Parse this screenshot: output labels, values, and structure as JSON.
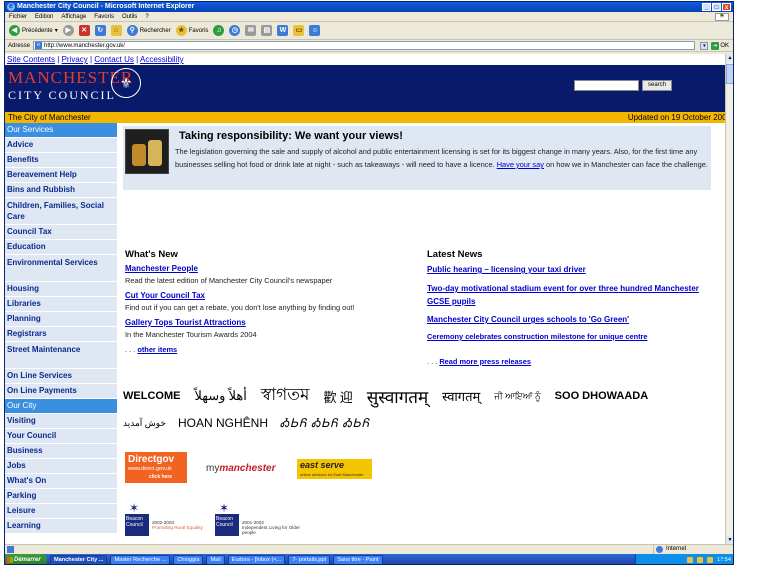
{
  "window": {
    "title": "Manchester City Council - Microsoft Internet Explorer",
    "controls": [
      "_",
      "□",
      "x"
    ]
  },
  "menu": [
    "Fichier",
    "Edition",
    "Affichage",
    "Favoris",
    "Outils",
    "?"
  ],
  "toolbar": {
    "back_label": "Précédente",
    "search_label": "Rechercher",
    "favorites_label": "Favoris"
  },
  "address": {
    "label": "Adresse",
    "url": "http://www.manchester.gov.uk/",
    "go_label": "OK"
  },
  "site": {
    "top_links": [
      "Site Contents",
      "Privacy",
      "Contact Us",
      "Accessibility"
    ],
    "logo_title": "MANCHESTER",
    "logo_subtitle": "CITY COUNCIL",
    "search_button": "search",
    "search_value": "",
    "strip_left": "The City of Manchester",
    "strip_right": "Updated on 19 October 2004"
  },
  "sidebar": [
    {
      "label": "Our Services",
      "head": true
    },
    {
      "label": "Advice"
    },
    {
      "label": "Benefits"
    },
    {
      "label": "Bereavement Help"
    },
    {
      "label": "Bins and Rubbish"
    },
    {
      "label": "Children, Families, Social Care",
      "tall": true
    },
    {
      "label": "Council Tax"
    },
    {
      "label": "Education"
    },
    {
      "label": "Environmental Services",
      "tall": true
    },
    {
      "label": "Housing"
    },
    {
      "label": "Libraries"
    },
    {
      "label": "Planning"
    },
    {
      "label": "Registrars"
    },
    {
      "label": "Street Maintenance",
      "tall": true
    },
    {
      "label": "On Line Services"
    },
    {
      "label": "On Line Payments"
    },
    {
      "label": "Our City",
      "head": true
    },
    {
      "label": "Visiting"
    },
    {
      "label": "Your Council"
    },
    {
      "label": "Business"
    },
    {
      "label": "Jobs"
    },
    {
      "label": "What's On"
    },
    {
      "label": "Parking"
    },
    {
      "label": "Leisure"
    },
    {
      "label": "Learning"
    }
  ],
  "feature": {
    "title": "Taking responsibility: We want your views!",
    "body": "The legislation governing the sale and supply of alcohol and public entertainment licensing is set for its biggest change in many years. Also, for the first time any businesses selling hot food or drink late at night - such as takeaways - will need to have a licence.",
    "link": "Have your say",
    "tail": " on how we in Manchester can face the challenge."
  },
  "whats_new": {
    "title": "What's New",
    "items": [
      {
        "link": "Manchester People",
        "desc": "Read the latest edition of Manchester City Council's newspaper"
      },
      {
        "link": "Cut Your Council Tax",
        "desc": "Find out if you can get a rebate, you don't lose anything by finding out!"
      },
      {
        "link": "Gallery Tops Tourist Attractions",
        "desc": "In the Manchester Tourism Awards 2004"
      }
    ],
    "more_prefix": ". . . ",
    "more_link": "other items"
  },
  "latest_news": {
    "title": "Latest News",
    "items": [
      "Public hearing – licensing your taxi driver",
      "Two-day motivational stadium event for over three hundred Manchester GCSE pupils",
      "Manchester City Council urges schools to 'Go Green'",
      "Ceremony celebrates construction milestone for unique centre"
    ],
    "more_prefix": ". . . ",
    "more_link": "Read more press releases"
  },
  "welcome": {
    "row1": [
      "WELCOME",
      "أهلاً وسهلاً",
      "স্বাগতম",
      "歡 迎",
      "सुस्वागतम्",
      "स्वागतम्",
      "ਜੀ ਆਇਆਂ ਨੂੰ",
      "SOO DHOWAADA"
    ],
    "row2": [
      "خوش آمدید",
      "HOAN NGHÊNH",
      "ᎣᏏᏲ ᎣᏏᏲ ᎣᏏᏲ"
    ]
  },
  "partners": {
    "directgov_name": "Directgov",
    "directgov_url": "www.direct.gov.uk",
    "directgov_click": "click here",
    "mymcr_prefix": "my",
    "mymcr_name": "manchester",
    "eastserve_name": "east serve",
    "eastserve_sub": "online services for East Manchester"
  },
  "beacons": [
    {
      "brand": "Beacon Council",
      "years": "2002-2003",
      "sub": "Promoting Rural Equality"
    },
    {
      "brand": "Beacon Council",
      "years": "2001-2002",
      "sub": "Independent Living for Older people"
    }
  ],
  "statusbar": {
    "zone": "Internet"
  },
  "taskbar": {
    "start": "Démarrer",
    "tasks": [
      {
        "label": "Manchester City ...",
        "active": true
      },
      {
        "label": "Master Recherche ..."
      },
      {
        "label": "Chioggia"
      },
      {
        "label": "Mail"
      },
      {
        "label": "Eudora - [Inbox (<..."
      },
      {
        "label": "7- portails.ppt"
      },
      {
        "label": "Sans titre - Paint"
      }
    ],
    "clock": "17:54"
  }
}
